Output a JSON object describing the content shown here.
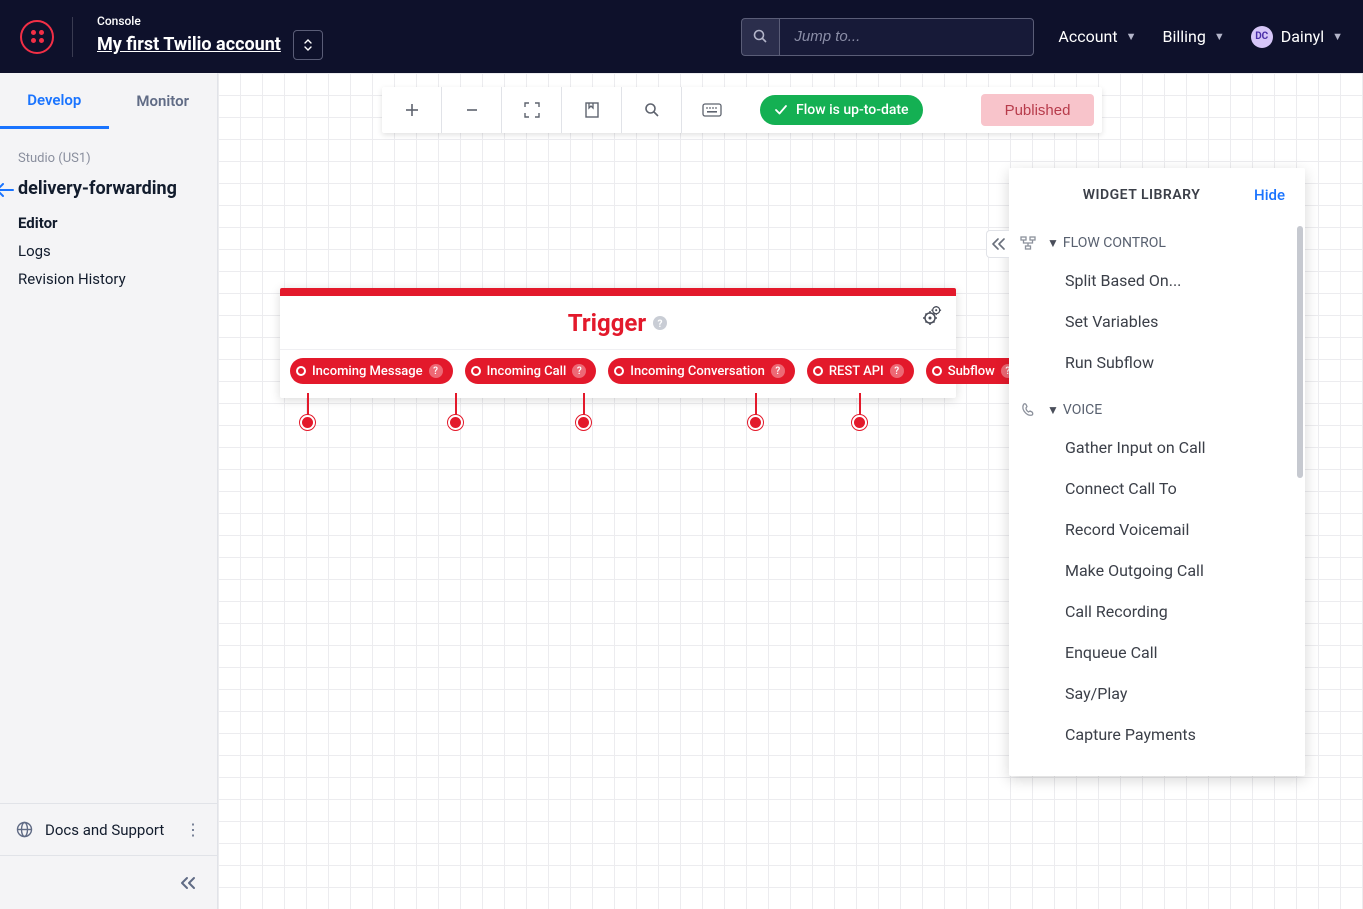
{
  "topbar": {
    "console_label": "Console",
    "account_name": "My first Twilio account",
    "search_placeholder": "Jump to...",
    "nav": {
      "account": "Account",
      "billing": "Billing",
      "user_initials": "DC",
      "user_name": "Dainyl"
    }
  },
  "sidebar": {
    "tabs": {
      "develop": "Develop",
      "monitor": "Monitor"
    },
    "studio_label": "Studio (US1)",
    "flow_title": "delivery-forwarding",
    "links": {
      "editor": "Editor",
      "logs": "Logs",
      "history": "Revision History"
    },
    "footer": {
      "docs": "Docs and Support"
    }
  },
  "toolbar": {
    "status_text": "Flow is up-to-date",
    "publish_label": "Published"
  },
  "trigger": {
    "title": "Trigger",
    "pills": [
      "Incoming Message",
      "Incoming Call",
      "Incoming Conversation",
      "REST API",
      "Subflow"
    ]
  },
  "widget_library": {
    "title": "WIDGET LIBRARY",
    "hide_label": "Hide",
    "sections": [
      {
        "name": "FLOW CONTROL",
        "items": [
          "Split Based On...",
          "Set Variables",
          "Run Subflow"
        ]
      },
      {
        "name": "VOICE",
        "items": [
          "Gather Input on Call",
          "Connect Call To",
          "Record Voicemail",
          "Make Outgoing Call",
          "Call Recording",
          "Enqueue Call",
          "Say/Play",
          "Capture Payments"
        ]
      }
    ]
  }
}
